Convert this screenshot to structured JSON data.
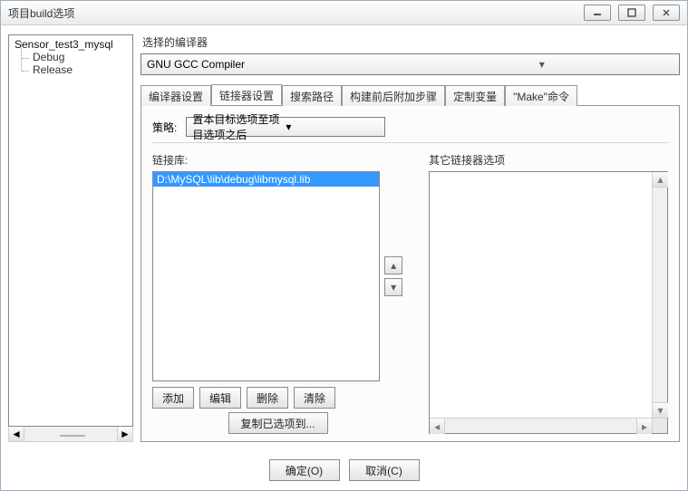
{
  "window": {
    "title": "项目build选项"
  },
  "tree": {
    "root": "Sensor_test3_mysql",
    "children": [
      "Debug",
      "Release"
    ]
  },
  "compiler": {
    "label": "选择的编译器",
    "value": "GNU GCC Compiler"
  },
  "tabs": [
    "编译器设置",
    "链接器设置",
    "搜索路径",
    "构建前后附加步骤",
    "定制变量",
    "\"Make\"命令"
  ],
  "active_tab": 1,
  "policy": {
    "label": "策略:",
    "value": "置本目标选项至项目选项之后"
  },
  "linklib": {
    "label": "链接库:",
    "items": [
      "D:\\MySQL\\lib\\debug\\libmysql.lib"
    ],
    "selected": 0,
    "buttons": {
      "add": "添加",
      "edit": "编辑",
      "delete": "删除",
      "clear": "清除"
    },
    "copy": "复制已选项到..."
  },
  "otheropts": {
    "label": "其它链接器选项",
    "value": ""
  },
  "footer": {
    "ok": "确定(O)",
    "cancel": "取消(C)"
  }
}
